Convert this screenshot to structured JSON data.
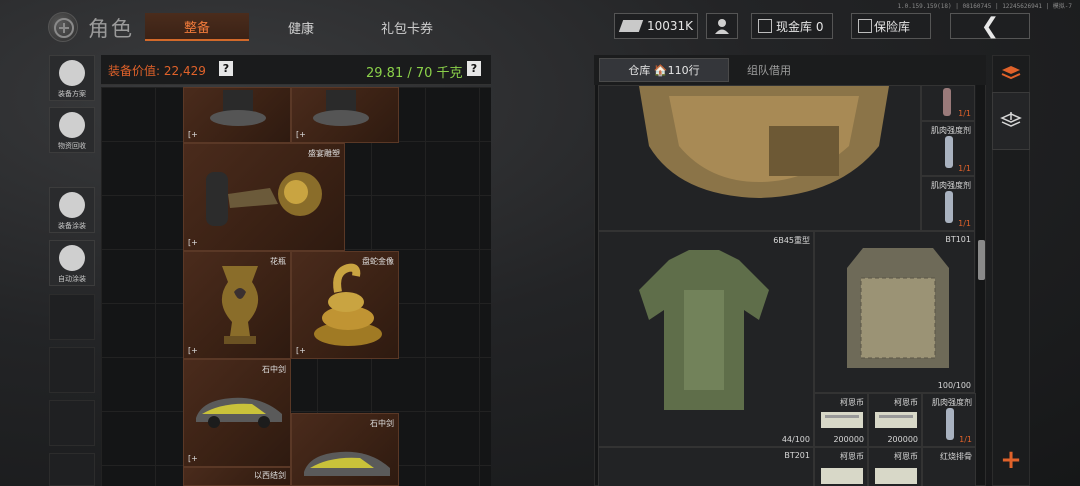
{
  "version": "1.0.159.159(18) | 08160745 | 12245626941 | 模拟-7",
  "header": {
    "title": "角色",
    "tabs": [
      {
        "label": "整备",
        "active": true
      },
      {
        "label": "健康",
        "active": false
      },
      {
        "label": "礼包卡券",
        "active": false
      }
    ],
    "currency_value": "10031K",
    "cash_label": "现金库 0",
    "safe_label": "保险库",
    "back_icon": "chevron-left-icon"
  },
  "sidebar": {
    "items": [
      {
        "label": "装备方案",
        "icon": "loadout-icon"
      },
      {
        "label": "物资回收",
        "icon": "recycle-icon"
      },
      {
        "label": "装备涂装",
        "icon": "paint-icon"
      },
      {
        "label": "自动涂装",
        "icon": "auto-paint-icon"
      }
    ]
  },
  "equipment": {
    "value_label": "装备价值: 22,429",
    "help": "?",
    "weight_label": "29.81 / 70 千克",
    "items": [
      {
        "name": "",
        "marker": "[+"
      },
      {
        "name": "",
        "marker": "[+"
      },
      {
        "name": "盛宴雕塑",
        "marker": "[+"
      },
      {
        "name": "花瓶",
        "marker": "[+"
      },
      {
        "name": "盘蛇金像",
        "marker": "[+"
      },
      {
        "name": "石中剑",
        "marker": "[+"
      },
      {
        "name": "石中剑",
        "marker": "[+"
      },
      {
        "name": "以西结剑",
        "marker": ""
      }
    ]
  },
  "warehouse": {
    "tabs": [
      {
        "label": "仓库 🏠110行",
        "active": true
      },
      {
        "label": "组队借用",
        "active": false
      }
    ],
    "items": [
      {
        "name": "",
        "count": "1/1",
        "orange": true
      },
      {
        "name": "肌肉强度剂",
        "count": "1/1",
        "orange": true
      },
      {
        "name": "肌肉强度剂",
        "count": "1/1",
        "orange": true
      },
      {
        "name": "6B45重型",
        "count": "44/100",
        "orange": false
      },
      {
        "name": "BT101",
        "count": "100/100",
        "orange": false
      },
      {
        "name": "柯恩币",
        "count": "200000",
        "orange": false
      },
      {
        "name": "柯恩币",
        "count": "200000",
        "orange": false
      },
      {
        "name": "肌肉强度剂",
        "count": "1/1",
        "orange": true
      },
      {
        "name": "BT201",
        "count": "",
        "orange": false
      },
      {
        "name": "柯恩币",
        "count": "",
        "orange": false
      },
      {
        "name": "柯恩币",
        "count": "",
        "orange": false
      },
      {
        "name": "红烧排骨",
        "count": "",
        "orange": false
      }
    ]
  },
  "rail": {
    "plus": "+"
  }
}
